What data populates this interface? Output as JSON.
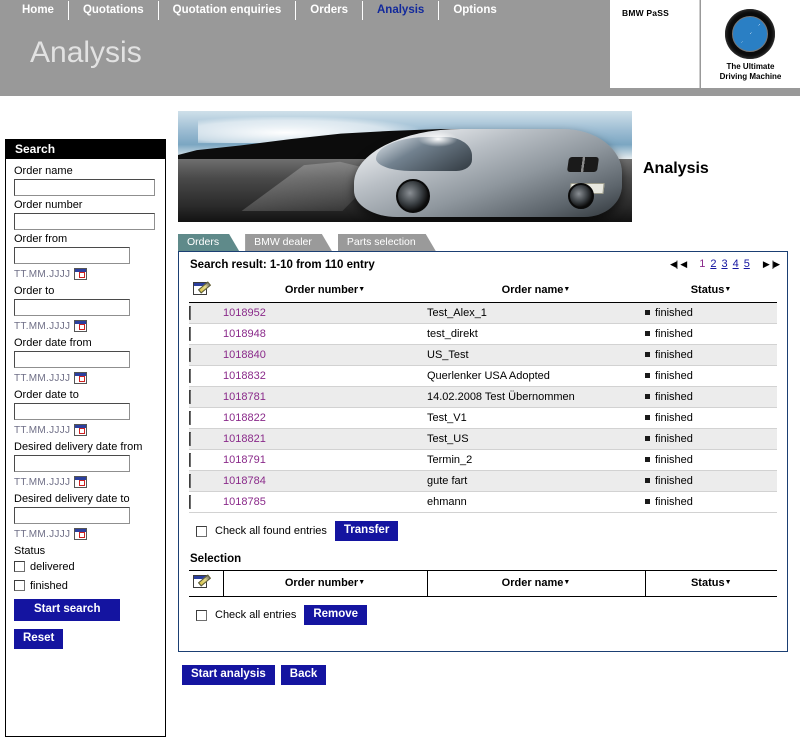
{
  "nav": {
    "items": [
      {
        "label": "Home",
        "active": false
      },
      {
        "label": "Quotations",
        "active": false
      },
      {
        "label": "Quotation enquiries",
        "active": false
      },
      {
        "label": "Orders",
        "active": false
      },
      {
        "label": "Analysis",
        "active": true
      },
      {
        "label": "Options",
        "active": false
      }
    ]
  },
  "header": {
    "page_title": "Analysis",
    "brand_name": "BMW PaSS",
    "logo_tagline_line1": "The Ultimate",
    "logo_tagline_line2": "Driving Machine",
    "accent_color": "#12299c",
    "bar_color": "#999999"
  },
  "banner": {
    "heading": "Analysis"
  },
  "sidebar": {
    "title": "Search",
    "date_hint": "TT.MM.JJJJ",
    "fields": [
      {
        "label": "Order name",
        "value": "",
        "has_date_hint": false,
        "wide": true
      },
      {
        "label": "Order number",
        "value": "",
        "has_date_hint": false,
        "wide": true
      },
      {
        "label": "Order from",
        "value": "",
        "has_date_hint": true,
        "wide": false
      },
      {
        "label": "Order to",
        "value": "",
        "has_date_hint": true,
        "wide": false
      },
      {
        "label": "Order date from",
        "value": "",
        "has_date_hint": true,
        "wide": false
      },
      {
        "label": "Order date to",
        "value": "",
        "has_date_hint": true,
        "wide": false
      },
      {
        "label": "Desired delivery date from",
        "value": "",
        "has_date_hint": true,
        "wide": false
      },
      {
        "label": "Desired delivery date to",
        "value": "",
        "has_date_hint": true,
        "wide": false
      }
    ],
    "status_label": "Status",
    "status_options": [
      {
        "label": "delivered",
        "checked": false
      },
      {
        "label": "finished",
        "checked": false
      }
    ],
    "start_search_label": "Start search",
    "reset_label": "Reset"
  },
  "tabs": [
    {
      "label": "Orders",
      "active": true
    },
    {
      "label": "BMW dealer",
      "active": false
    },
    {
      "label": "Parts selection",
      "active": false
    }
  ],
  "results": {
    "summary": "Search result: 1-10 from 110 entry",
    "pager": {
      "first_icon": "◀|",
      "prev_icon": "◀",
      "next_icon": "▶",
      "last_icon": "|▶",
      "pages": [
        {
          "label": "1",
          "current": true
        },
        {
          "label": "2",
          "current": false
        },
        {
          "label": "3",
          "current": false
        },
        {
          "label": "4",
          "current": false
        },
        {
          "label": "5",
          "current": false
        }
      ]
    },
    "columns": {
      "check": "edit-icon",
      "order_number": "Order number",
      "order_name": "Order name",
      "status": "Status"
    },
    "rows": [
      {
        "order_number": "1018952",
        "order_name": "Test_Alex_1",
        "status": "finished"
      },
      {
        "order_number": "1018948",
        "order_name": "test_direkt",
        "status": "finished"
      },
      {
        "order_number": "1018840",
        "order_name": "US_Test",
        "status": "finished"
      },
      {
        "order_number": "1018832",
        "order_name": "Querlenker USA Adopted",
        "status": "finished"
      },
      {
        "order_number": "1018781",
        "order_name": "14.02.2008 Test Übernommen",
        "status": "finished"
      },
      {
        "order_number": "1018822",
        "order_name": "Test_V1",
        "status": "finished"
      },
      {
        "order_number": "1018821",
        "order_name": "Test_US",
        "status": "finished"
      },
      {
        "order_number": "1018791",
        "order_name": "Termin_2",
        "status": "finished"
      },
      {
        "order_number": "1018784",
        "order_name": "gute fart",
        "status": "finished"
      },
      {
        "order_number": "1018785",
        "order_name": "ehmann",
        "status": "finished"
      }
    ],
    "check_all_found_label": "Check all found entries",
    "transfer_label": "Transfer"
  },
  "selection": {
    "title": "Selection",
    "columns": {
      "order_number": "Order number",
      "order_name": "Order name",
      "status": "Status"
    },
    "rows": [],
    "check_all_label": "Check all entries",
    "remove_label": "Remove"
  },
  "footer": {
    "start_analysis_label": "Start analysis",
    "back_label": "Back"
  }
}
